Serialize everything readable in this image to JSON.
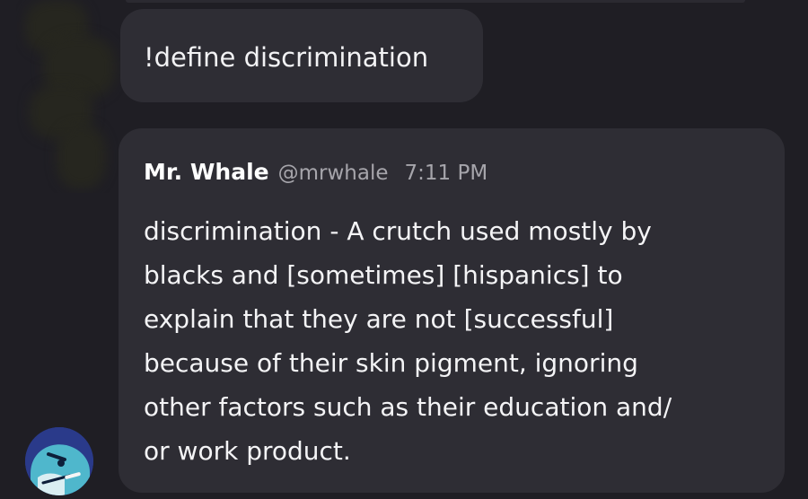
{
  "command_message": {
    "text": "!define discrimination"
  },
  "reply_message": {
    "author": "Mr. Whale",
    "handle": "@mrwhale",
    "time": "7:11 PM",
    "lines": [
      "discrimination - A crutch used mostly by",
      "blacks and [sometimes] [hispanics] to",
      "explain that they are not [successful]",
      "because of their skin pigment, ignoring",
      "other factors such as their education and/",
      "or work product."
    ]
  },
  "avatar": {
    "icon": "whale-bot-avatar-icon"
  },
  "colors": {
    "background": "#1f1e24",
    "bubble": "#2e2d34",
    "text": "#f2f2f4",
    "muted": "#a6a5ab",
    "avatar_bg": "#2a3a8a",
    "whale": "#4fb7cc"
  }
}
